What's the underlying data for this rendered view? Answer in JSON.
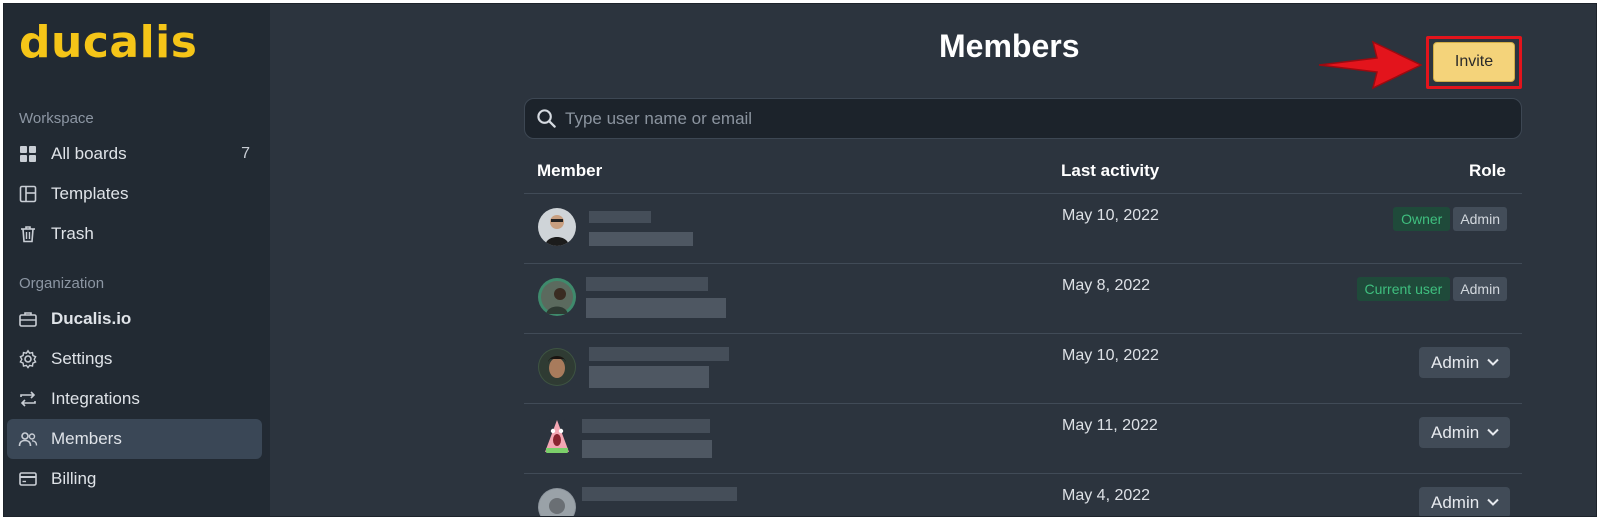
{
  "sidebar": {
    "logo": "ducalis",
    "workspace_label": "Workspace",
    "workspace_items": [
      {
        "label": "All boards",
        "icon": "grid-icon",
        "count": "7"
      },
      {
        "label": "Templates",
        "icon": "template-icon"
      },
      {
        "label": "Trash",
        "icon": "trash-icon"
      }
    ],
    "organization_label": "Organization",
    "organization_items": [
      {
        "label": "Ducalis.io",
        "icon": "briefcase-icon"
      },
      {
        "label": "Settings",
        "icon": "gear-icon"
      },
      {
        "label": "Integrations",
        "icon": "sync-icon"
      },
      {
        "label": "Members",
        "icon": "users-icon",
        "active": true
      },
      {
        "label": "Billing",
        "icon": "credit-card-icon"
      }
    ]
  },
  "main": {
    "title": "Members",
    "invite_label": "Invite",
    "search": {
      "placeholder": "Type user name or email",
      "value": ""
    },
    "columns": {
      "member": "Member",
      "last_activity": "Last activity",
      "role": "Role"
    },
    "rows": [
      {
        "last_activity": "May 10, 2022",
        "tags": [
          "Owner",
          "Admin"
        ]
      },
      {
        "last_activity": "May 8, 2022",
        "tags": [
          "Current user",
          "Admin"
        ]
      },
      {
        "last_activity": "May 10, 2022",
        "role": "Admin"
      },
      {
        "last_activity": "May 11, 2022",
        "role": "Admin"
      },
      {
        "last_activity": "May 4, 2022",
        "role": "Admin"
      }
    ]
  },
  "colors": {
    "brand": "#f5c518",
    "invite_button": "#f4d37a",
    "highlight": "#e3141c",
    "owner_tag": "#3fbf7f"
  }
}
